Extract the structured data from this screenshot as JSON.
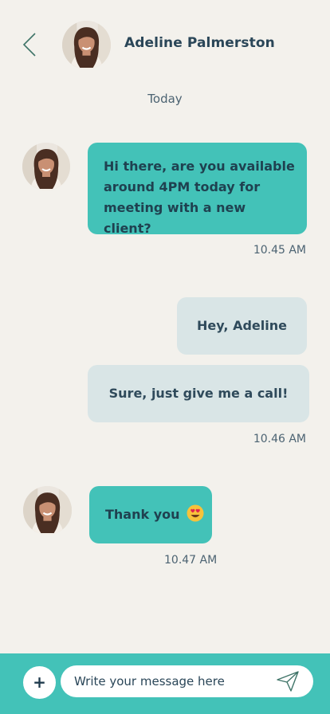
{
  "header": {
    "back_icon": "chevron-left-icon",
    "contact_name": "Adeline Palmerston",
    "avatar_icon": "contact-avatar"
  },
  "date_separator": "Today",
  "messages": [
    {
      "direction": "incoming",
      "text": "Hi there, are you available around 4PM today for meeting with a new client?"
    },
    {
      "direction": "outgoing",
      "text": "Hey, Adeline"
    },
    {
      "direction": "outgoing",
      "text": "Sure, just give me a call!"
    },
    {
      "direction": "incoming",
      "text": "Thank you",
      "emoji": "heart-eyes-emoji"
    }
  ],
  "timestamps": [
    "10.45 AM",
    "10.46 AM",
    "10.47 AM"
  ],
  "composer": {
    "add_label": "+",
    "placeholder": "Write your message here",
    "send_icon": "send-icon"
  },
  "colors": {
    "background": "#f3f1ec",
    "incoming_bubble": "#43c2b8",
    "outgoing_bubble": "#d9e5e6",
    "text": "#2a4658"
  }
}
